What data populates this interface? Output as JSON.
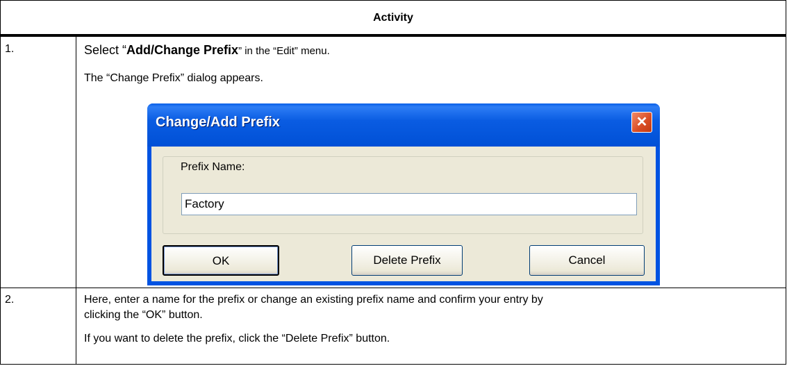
{
  "table": {
    "header": "Activity",
    "rows": [
      {
        "number": "1.",
        "line1_pre": "Select “",
        "line1_bold": "Add/Change Prefix",
        "line1_post": "” in the “Edit” menu.",
        "line2": "The “Change Prefix” dialog appears."
      },
      {
        "number": "2.",
        "line1": "Here, enter a name for the prefix or change an existing prefix name and confirm your entry by",
        "line2": "clicking the “OK” button.",
        "line3": "If you want to delete the prefix, click the “Delete Prefix” button."
      }
    ]
  },
  "dialog": {
    "title": "Change/Add Prefix",
    "close_glyph": "✕",
    "group_label": "Prefix Name:",
    "input_value": "Factory",
    "buttons": {
      "ok": "OK",
      "delete": "Delete Prefix",
      "cancel": "Cancel"
    }
  },
  "colors": {
    "titlebar": "#0053e2",
    "close_button": "#d84b22",
    "dialog_face": "#ece9d8"
  }
}
